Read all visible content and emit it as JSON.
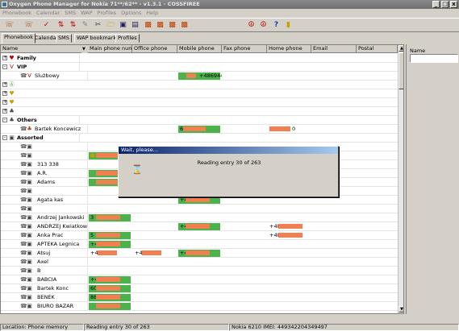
{
  "window": {
    "title": "Oxygen Phone Manager for Nokia 71**/62** - v1.3.1 - COSSFIREE",
    "minimize": "_",
    "restore": "□",
    "close": "x"
  },
  "menu": [
    "Phonebook",
    "Calendar",
    "SMS",
    "WAP",
    "Profiles",
    "Options",
    "Help"
  ],
  "tabs": [
    "Phonebook",
    "Calendar",
    "SMS",
    "WAP bookmarks",
    "Profiles"
  ],
  "columns": [
    "Name",
    "Main phone num...",
    "Office phone",
    "Mobile phone",
    "Fax phone",
    "Home phone",
    "Email",
    "Postal"
  ],
  "groups": {
    "family": "Family",
    "vip": "VIP",
    "vip_item": "Slużbowy",
    "vip_item_prefix": "VIP",
    "vip_mobile": "+486944",
    "others": "Others",
    "others_item": "Bartek Koncewicz",
    "others_mobile": "6",
    "others_home": "0",
    "assorted": "Assorted"
  },
  "assorted_rows": [
    {
      "name": "",
      "main": "",
      "office": "",
      "mobile": "",
      "home": ""
    },
    {
      "name": "",
      "main": "",
      "office": "",
      "mobile": "",
      "home": ""
    },
    {
      "name": "313 338",
      "main": "",
      "office": "",
      "mobile": "",
      "home": ""
    },
    {
      "name": "A.R.",
      "main": "",
      "office": "",
      "mobile": "",
      "home": ""
    },
    {
      "name": "Adams",
      "main": "",
      "office": "",
      "mobile": "",
      "home": ""
    },
    {
      "name": "",
      "main": "",
      "office": "",
      "mobile": "",
      "home": ""
    },
    {
      "name": "Agata kas",
      "main": "",
      "office": "",
      "mobile": "+48",
      "home": ""
    },
    {
      "name": "",
      "main": "",
      "office": "",
      "mobile": "",
      "home": ""
    },
    {
      "name": "Andrzej Jankowski",
      "main": "3",
      "office": "",
      "mobile": "",
      "home": ""
    },
    {
      "name": "ANDRZEJ Kwiatkow...",
      "main": "",
      "office": "",
      "mobile": "+489",
      "home": "+48"
    },
    {
      "name": "Anka Prac",
      "main": "5",
      "office": "",
      "mobile": "",
      "home": "+48"
    },
    {
      "name": "APTEKA Legnica",
      "main": "+417",
      "office": "",
      "mobile": "",
      "home": ""
    },
    {
      "name": "Atsuj",
      "main": "+48 5",
      "office": "+4 34",
      "mobile": "+48",
      "home": ""
    },
    {
      "name": "Axel",
      "main": "",
      "office": "",
      "mobile": "",
      "home": ""
    },
    {
      "name": "B",
      "main": "",
      "office": "",
      "mobile": "",
      "home": ""
    },
    {
      "name": "BABCIA",
      "main": "+48",
      "office": "",
      "mobile": "",
      "home": ""
    },
    {
      "name": "Bartek Konc",
      "main": "606",
      "office": "",
      "mobile": "",
      "home": ""
    },
    {
      "name": "BENEK",
      "main": "88",
      "office": "",
      "mobile": "",
      "home": ""
    },
    {
      "name": "BIURO BAZAR",
      "main": "",
      "office": "",
      "mobile": "",
      "home": ""
    }
  ],
  "right_pane": {
    "label": "Name",
    "value": ""
  },
  "dialog": {
    "title": "Wait, please...",
    "message": "Reading entry 30 of 263"
  },
  "status": {
    "location": "Location: Phone memory",
    "progress": "Reading entry 30 of 263",
    "device": "Nokia 6210 IMEI: 449342204349497"
  },
  "colors": {
    "highlight_green": "#4cb24c",
    "redaction_orange": "#f08050",
    "dialog_title": "#0a246a"
  }
}
